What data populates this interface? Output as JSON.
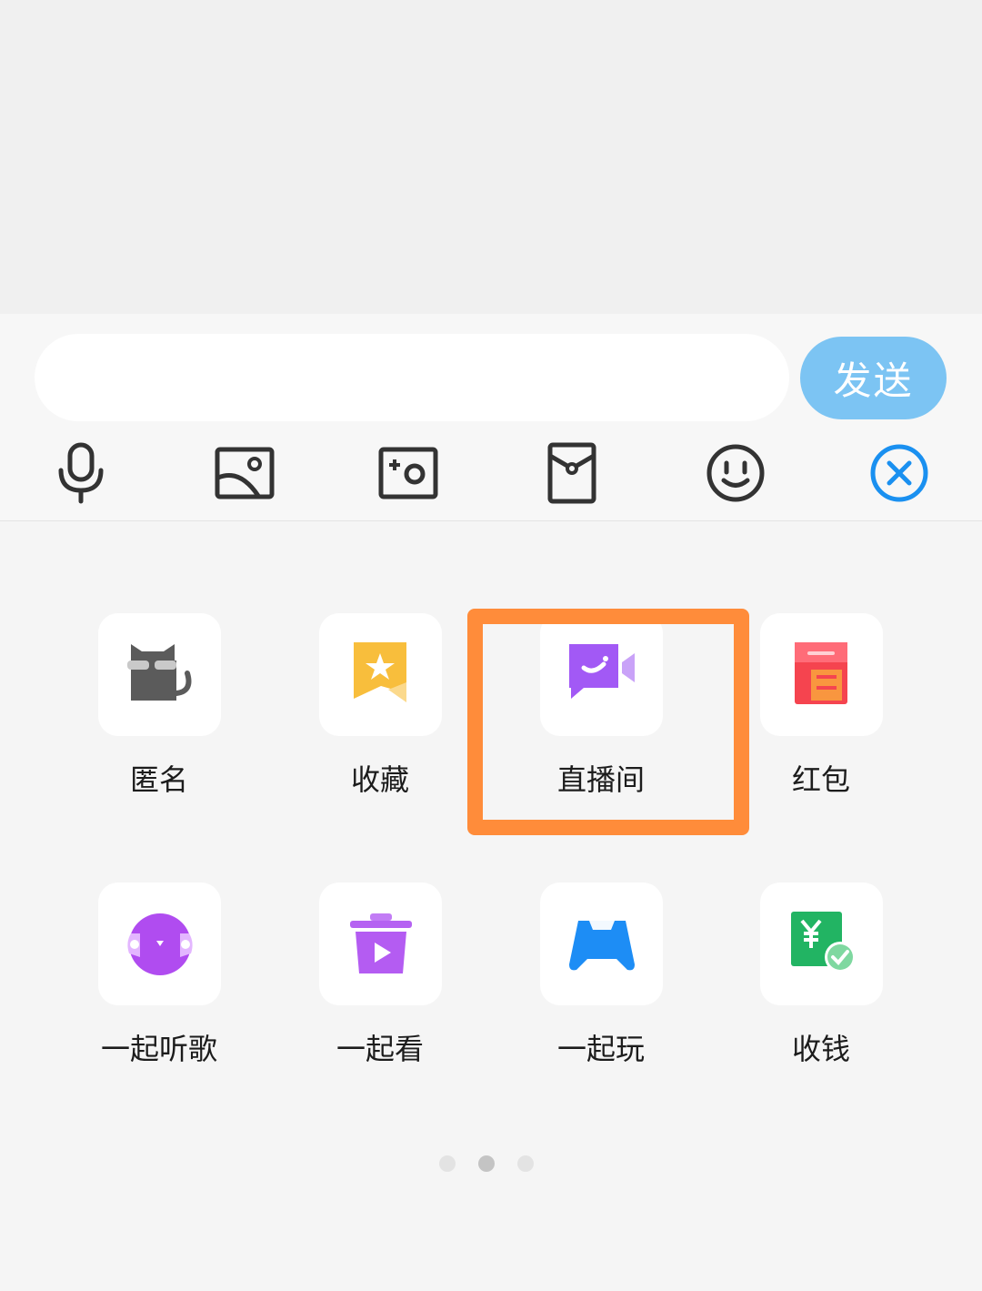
{
  "input": {
    "placeholder": "",
    "value": "",
    "send_label": "发送"
  },
  "toolbar": [
    {
      "name": "microphone-icon"
    },
    {
      "name": "image-icon"
    },
    {
      "name": "camera-icon"
    },
    {
      "name": "red-packet-icon"
    },
    {
      "name": "emoji-icon"
    },
    {
      "name": "close-panel-icon"
    }
  ],
  "panel": {
    "items": [
      {
        "label": "匿名",
        "icon": "anonymous-cat-icon"
      },
      {
        "label": "收藏",
        "icon": "favorites-icon"
      },
      {
        "label": "直播间",
        "icon": "live-room-icon"
      },
      {
        "label": "红包",
        "icon": "red-packet-icon"
      },
      {
        "label": "一起听歌",
        "icon": "listen-together-icon"
      },
      {
        "label": "一起看",
        "icon": "watch-together-icon"
      },
      {
        "label": "一起玩",
        "icon": "play-together-icon"
      },
      {
        "label": "收钱",
        "icon": "receive-money-icon"
      }
    ],
    "highlighted_item": "直播间",
    "page_count": 3,
    "current_page": 2
  },
  "colors": {
    "send_button": "#7cc4f3",
    "highlight": "#ff8c3a",
    "close_icon": "#1a90f0"
  }
}
